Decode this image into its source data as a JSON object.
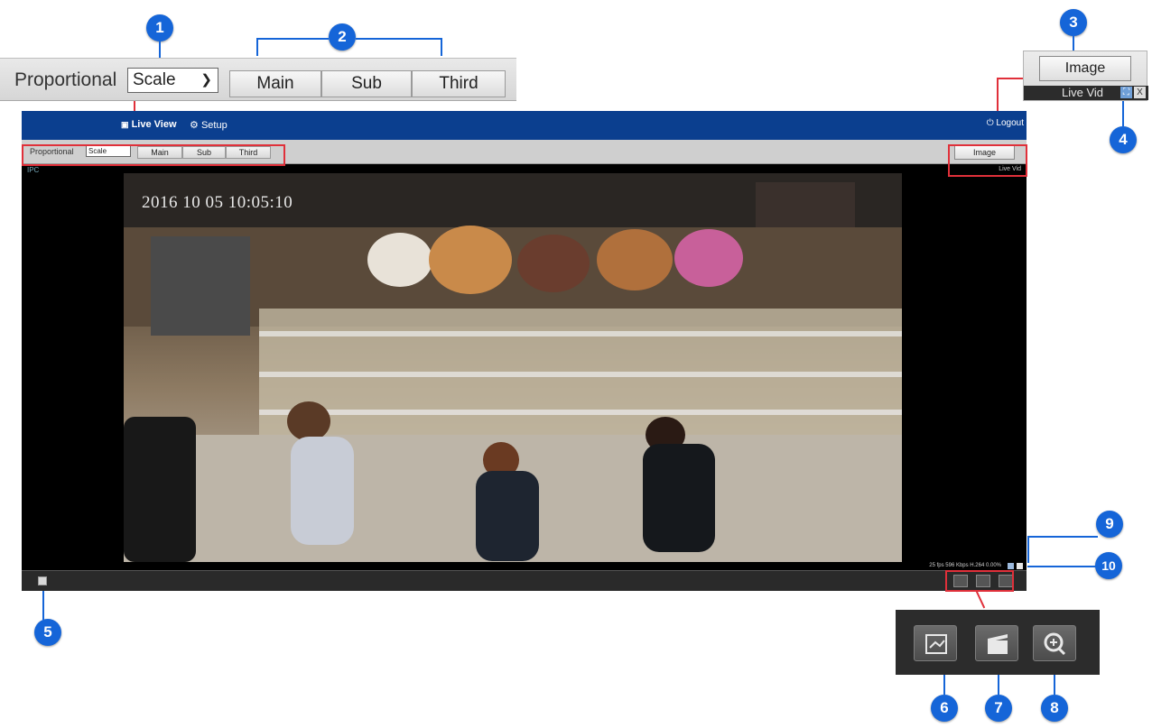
{
  "toolbar": {
    "proportional_label": "Proportional",
    "scale_value": "Scale",
    "stream_buttons": [
      "Main",
      "Sub",
      "Third"
    ],
    "image_button": "Image"
  },
  "nav": {
    "live_view": "Live View",
    "setup": "Setup",
    "logout": "Logout"
  },
  "image_panel": {
    "live_video_label": "Live Vid",
    "close_label": "X"
  },
  "video": {
    "timestamp": "2016 10 05 10:05:10",
    "channel_label": "IPC",
    "live_video_small": "Live Vid",
    "stats": "25 fps 596 Kbps H.264 0.00%"
  },
  "callouts": [
    "1",
    "2",
    "3",
    "4",
    "5",
    "6",
    "7",
    "8",
    "9",
    "10"
  ],
  "colors": {
    "callout_blue": "#1565d8",
    "highlight_red": "#e0303a",
    "nav_blue": "#0b3f8f"
  },
  "icons": {
    "snapshot": "snapshot-icon",
    "record": "record-icon",
    "digital_zoom": "zoom-in-icon",
    "fullscreen": "fullscreen-icon",
    "close": "close-icon",
    "live_view": "monitor-icon",
    "setup": "gear-icon",
    "logout": "power-icon",
    "start_video": "video-toggle-icon"
  }
}
